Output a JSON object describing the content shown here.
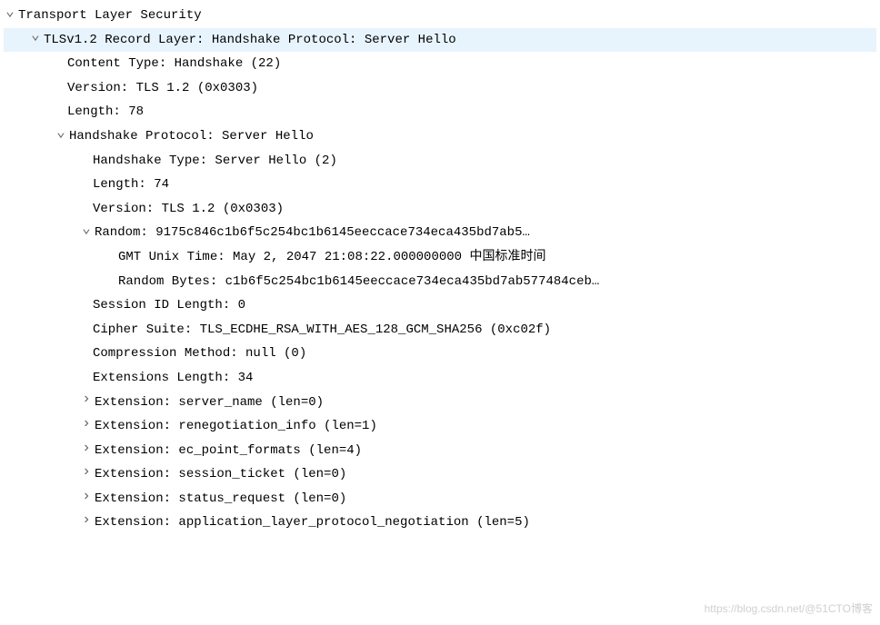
{
  "root": {
    "label": "Transport Layer Security"
  },
  "record_layer": {
    "label": "TLSv1.2 Record Layer: Handshake Protocol: Server Hello",
    "content_type": "Content Type: Handshake (22)",
    "version": "Version: TLS 1.2 (0x0303)",
    "length": "Length: 78"
  },
  "handshake": {
    "label": "Handshake Protocol: Server Hello",
    "type": "Handshake Type: Server Hello (2)",
    "length": "Length: 74",
    "version": "Version: TLS 1.2 (0x0303)",
    "random": {
      "label": "Random: 9175c846c1b6f5c254bc1b6145eeccace734eca435bd7ab5…",
      "gmt_time": "GMT Unix Time: May  2, 2047 21:08:22.000000000 中国标准时间",
      "random_bytes": "Random Bytes: c1b6f5c254bc1b6145eeccace734eca435bd7ab577484ceb…"
    },
    "session_id_length": "Session ID Length: 0",
    "cipher_suite": "Cipher Suite: TLS_ECDHE_RSA_WITH_AES_128_GCM_SHA256 (0xc02f)",
    "compression": "Compression Method: null (0)",
    "extensions_length": "Extensions Length: 34",
    "extensions": [
      "Extension: server_name (len=0)",
      "Extension: renegotiation_info (len=1)",
      "Extension: ec_point_formats (len=4)",
      "Extension: session_ticket (len=0)",
      "Extension: status_request (len=0)",
      "Extension: application_layer_protocol_negotiation (len=5)"
    ]
  },
  "watermark": "https://blog.csdn.net/@51CTO博客"
}
